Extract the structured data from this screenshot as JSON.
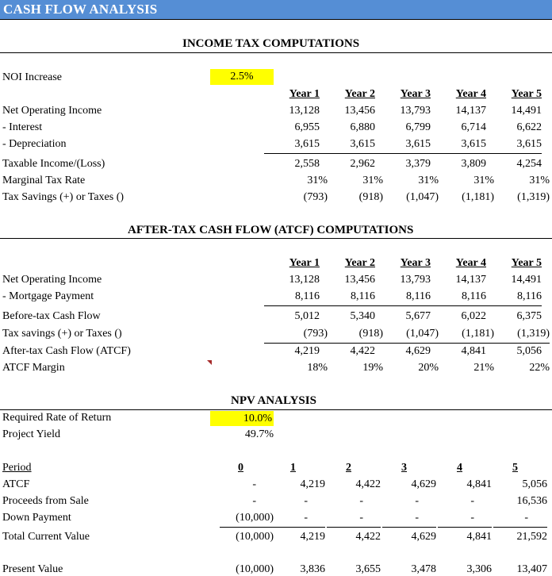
{
  "header": {
    "title": "CASH FLOW ANALYSIS"
  },
  "colors": {
    "banner": "#558ed5",
    "input_highlight": "#ffff00",
    "comment_marker": "#a52a2a"
  },
  "income_tax": {
    "title": "INCOME TAX COMPUTATIONS",
    "noi_increase_label": "NOI Increase",
    "noi_increase_value": "2.5%",
    "years": [
      "Year 1",
      "Year 2",
      "Year 3",
      "Year 4",
      "Year 5"
    ],
    "rows": [
      {
        "label": "Net Operating Income",
        "values": [
          "13,128",
          "13,456",
          "13,793",
          "14,137",
          "14,491"
        ]
      },
      {
        "label": " - Interest",
        "values": [
          "6,955",
          "6,880",
          "6,799",
          "6,714",
          "6,622"
        ]
      },
      {
        "label": " - Depreciation",
        "values": [
          "3,615",
          "3,615",
          "3,615",
          "3,615",
          "3,615"
        ]
      },
      {
        "label": "Taxable Income/(Loss)",
        "values": [
          "2,558",
          "2,962",
          "3,379",
          "3,809",
          "4,254"
        ]
      },
      {
        "label": "Marginal Tax Rate",
        "values": [
          "31%",
          "31%",
          "31%",
          "31%",
          "31%"
        ]
      },
      {
        "label": "Tax Savings (+) or Taxes ()",
        "values": [
          "(793)",
          "(918)",
          "(1,047)",
          "(1,181)",
          "(1,319)"
        ]
      }
    ]
  },
  "atcf": {
    "title": "AFTER-TAX CASH FLOW (ATCF) COMPUTATIONS",
    "years": [
      "Year 1",
      "Year 2",
      "Year 3",
      "Year 4",
      "Year 5"
    ],
    "rows": [
      {
        "label": "Net Operating Income",
        "values": [
          "13,128",
          "13,456",
          "13,793",
          "14,137",
          "14,491"
        ]
      },
      {
        "label": " - Mortgage Payment",
        "values": [
          "8,116",
          "8,116",
          "8,116",
          "8,116",
          "8,116"
        ]
      },
      {
        "label": "Before-tax Cash Flow",
        "values": [
          "5,012",
          "5,340",
          "5,677",
          "6,022",
          "6,375"
        ]
      },
      {
        "label": "Tax savings (+) or Taxes ()",
        "values": [
          "(793)",
          "(918)",
          "(1,047)",
          "(1,181)",
          "(1,319)"
        ]
      },
      {
        "label": "After-tax Cash Flow (ATCF)",
        "values": [
          "4,219",
          "4,422",
          "4,629",
          "4,841",
          "5,056"
        ]
      },
      {
        "label": "ATCF Margin",
        "values": [
          "18%",
          "19%",
          "20%",
          "21%",
          "22%"
        ]
      }
    ]
  },
  "npv": {
    "title": "NPV ANALYSIS",
    "required_rate_label": "Required Rate of Return",
    "required_rate_value": "10.0%",
    "project_yield_label": "Project Yield",
    "project_yield_value": "49.7%",
    "period_label": "Period",
    "periods": [
      "0",
      "1",
      "2",
      "3",
      "4",
      "5"
    ],
    "rows": [
      {
        "label": "ATCF",
        "values": [
          "-",
          "4,219",
          "4,422",
          "4,629",
          "4,841",
          "5,056"
        ]
      },
      {
        "label": "Proceeds from Sale",
        "values": [
          "-",
          "-",
          "-",
          "-",
          "-",
          "16,536"
        ]
      },
      {
        "label": "Down Payment",
        "values": [
          "(10,000)",
          "-",
          "-",
          "-",
          "-",
          "-"
        ]
      },
      {
        "label": "Total Current Value",
        "values": [
          "(10,000)",
          "4,219",
          "4,422",
          "4,629",
          "4,841",
          "21,592"
        ]
      },
      {
        "label": "Present Value",
        "values": [
          "(10,000)",
          "3,836",
          "3,655",
          "3,478",
          "3,306",
          "13,407"
        ]
      }
    ]
  }
}
